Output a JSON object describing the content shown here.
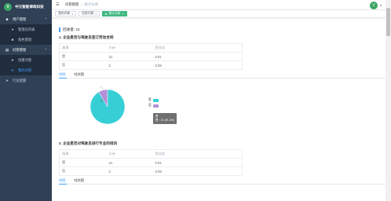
{
  "app": {
    "title": "中元智能律政科技",
    "logo_letter": "V"
  },
  "sidebar": {
    "items": [
      {
        "label": "用户管理",
        "icon": "users-icon"
      },
      {
        "label": "管理员列表"
      },
      {
        "label": "角色管理"
      },
      {
        "label": "问卷管理",
        "icon": "clipboard-icon"
      },
      {
        "label": "创建问卷"
      },
      {
        "label": "我的问卷"
      },
      {
        "label": "行业配置",
        "icon": "send-icon"
      }
    ]
  },
  "navbar": {
    "breadcrumb": [
      "问卷管理",
      "统计分析"
    ],
    "avatar_letter": "V"
  },
  "tags": [
    "我的问卷",
    "回答列表",
    "统计分析"
  ],
  "summary": {
    "count_label": "回收量: 23"
  },
  "questions": [
    {
      "title": "1. 企业是否与驾驶员签订劳动合同",
      "headers": [
        "选项",
        "小计",
        "百分比"
      ],
      "rows": [
        [
          "是",
          "21",
          "0.91"
        ],
        [
          "否",
          "2",
          "0.09"
        ]
      ],
      "tabs": [
        "饼图",
        "柱状图"
      ]
    },
    {
      "title": "2. 企业是否对驾驶员进行专业的培训",
      "headers": [
        "选项",
        "小计",
        "百分比"
      ],
      "rows": [
        [
          "是",
          "21",
          "0.91"
        ],
        [
          "否",
          "2",
          "0.09"
        ]
      ],
      "tabs": [
        "饼图",
        "柱状图"
      ]
    }
  ],
  "chart_data": {
    "type": "pie",
    "categories": [
      "是",
      "否"
    ],
    "values": [
      21,
      2
    ],
    "colors": [
      "#36cfd6",
      "#b390d6"
    ],
    "legend": [
      "是",
      "否"
    ],
    "tooltip_name": "是",
    "tooltip_value": "是 : 21 (91.3%)",
    "slice_label": "否"
  }
}
